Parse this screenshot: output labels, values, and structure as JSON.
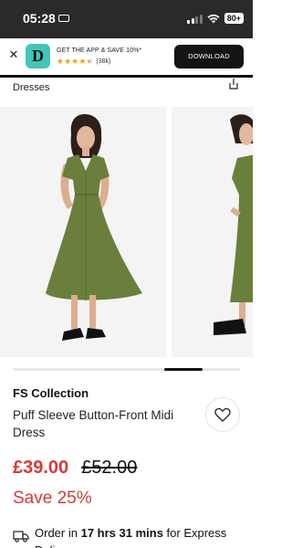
{
  "status_bar": {
    "time": "05:28",
    "battery": "80+"
  },
  "app_banner": {
    "logo_letter": "D",
    "title": "GET THE APP & SAVE 10%*",
    "rating_stars": 4.5,
    "review_count": "(38k)",
    "download_label": "DOWNLOAD"
  },
  "breadcrumb": {
    "label": "Dresses"
  },
  "gallery": {
    "dress_color": "#6a7f3c"
  },
  "product": {
    "brand": "FS Collection",
    "name": "Puff Sleeve Button-Front Midi Dress",
    "price_now": "£39.00",
    "price_was": "£52.00",
    "save": "Save 25%"
  },
  "delivery": {
    "prefix": "Order in",
    "countdown": "17 hrs 31 mins",
    "suffix": "for Express Delivery"
  },
  "colors": {
    "sale_red": "#d63a3a",
    "banner_teal": "#43c6b6",
    "star_gold": "#e9a41c"
  }
}
